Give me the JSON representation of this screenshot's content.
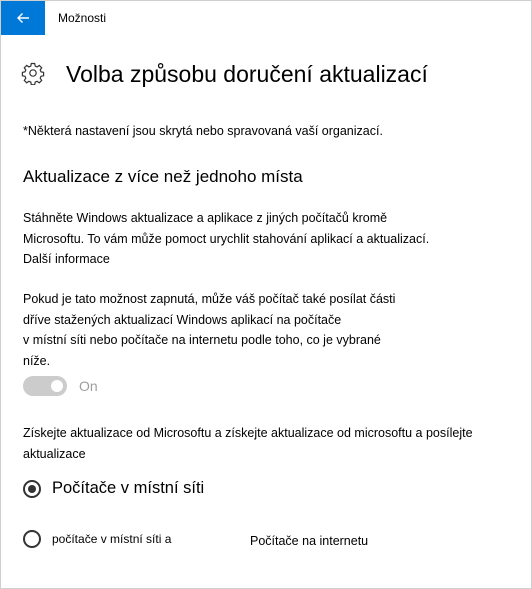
{
  "window": {
    "title": "Možnosti"
  },
  "page": {
    "title": "Volba způsobu doručení aktualizací"
  },
  "note": "*Některá nastavení jsou skrytá nebo spravovaná vaší organizací.",
  "section": {
    "title": "Aktualizace z více než jednoho místa",
    "description_lines": [
      "Stáhněte Windows aktualizace a aplikace z jiných počítačů kromě",
      "Microsoftu. To vám může pomoct urychlit stahování aplikací a aktualizací."
    ],
    "more_info_link": "Další informace",
    "explanation_lines": [
      "Pokud je tato možnost zapnutá, může váš počítač také posílat části",
      "dříve stažených aktualizací Windows aplikací na počítače",
      "v místní síti nebo počítače na internetu podle toho, co je vybrané",
      "níže."
    ],
    "toggle": {
      "state_label": "On",
      "on": true,
      "disabled": true
    },
    "radio_prompt_lines": [
      "Získejte aktualizace od Microsoftu a získejte aktualizace od microsoftu a posílejte",
      "aktualizace"
    ],
    "radio_options": [
      {
        "label": "Počítače v místní síti",
        "selected": true
      },
      {
        "label": "počítače v místní síti a",
        "label_extra": "Počítače na internetu",
        "selected": false
      }
    ]
  },
  "colors": {
    "accent": "#0078d7",
    "toggle_disabled": "#cccccc",
    "disabled_text": "#9e9e9e"
  },
  "icons": {
    "back": "back-arrow-icon",
    "settings": "gear-icon"
  }
}
